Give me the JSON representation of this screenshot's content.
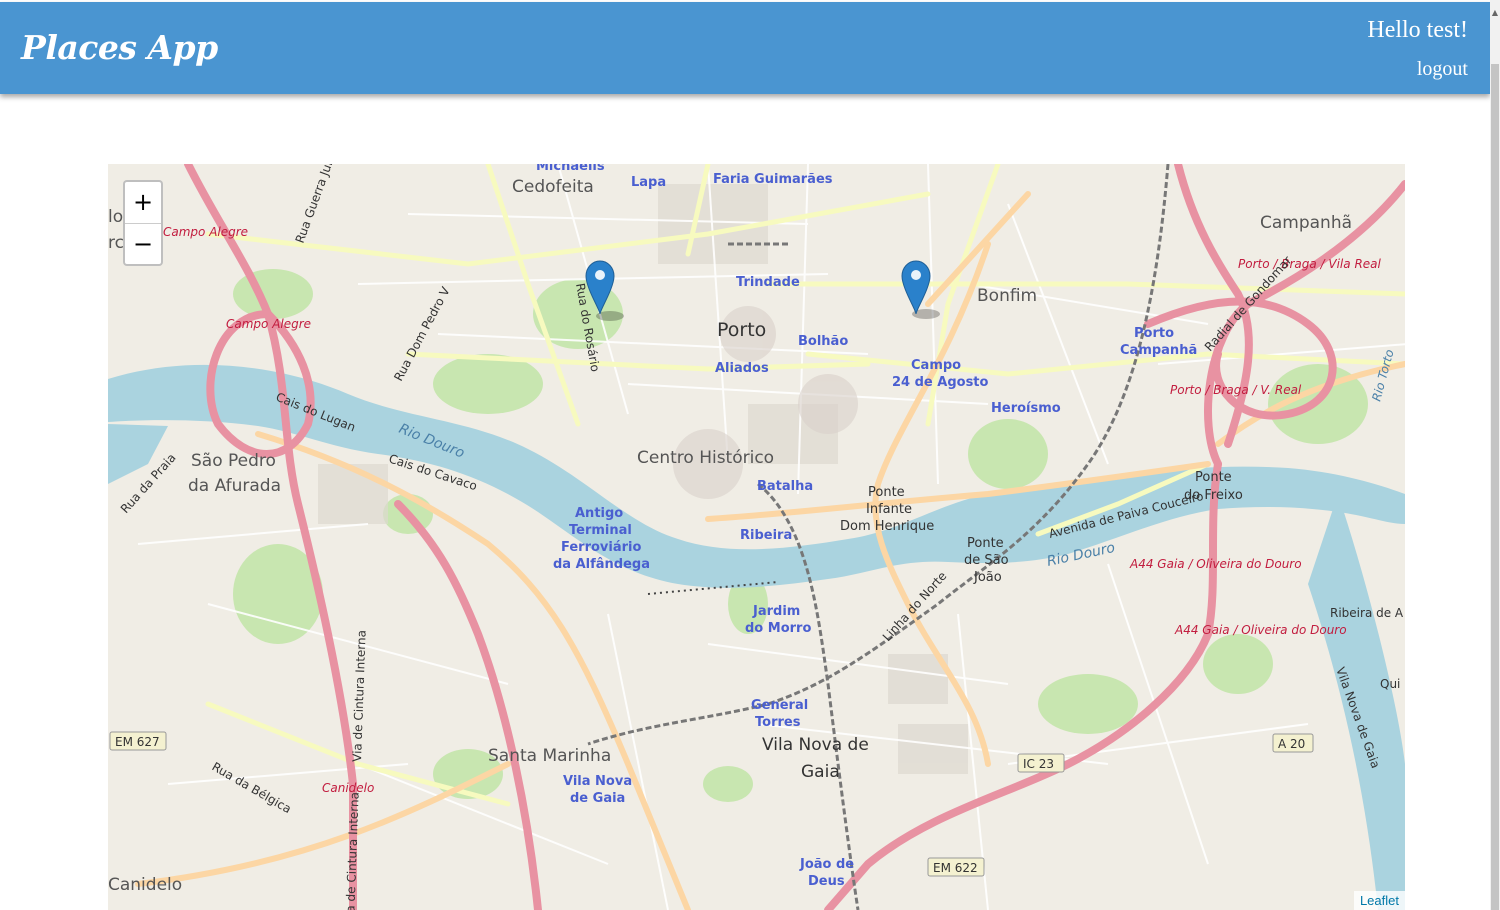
{
  "header": {
    "app_title": "Places App",
    "greeting": "Hello test!",
    "logout_label": "logout",
    "color": "#4a95d1"
  },
  "map": {
    "zoom_in_label": "+",
    "zoom_out_label": "−",
    "attribution": "Leaflet",
    "markers_count": 2,
    "place_labels": {
      "michaelis": "Michaelis",
      "cedofeita": "Cedofeita",
      "lapa": "Lapa",
      "faria_guimaraes": "Faria Guimarães",
      "campanha": "Campanhã",
      "campo_alegre_1": "Campo Alegre",
      "campo_alegre_2": "Campo Alegre",
      "trindade": "Trindade",
      "porto": "Porto",
      "bolhao": "Bolhão",
      "bonfim": "Bonfim",
      "aliados": "Aliados",
      "campo_24": "Campo",
      "campo_24_b": "24 de Agosto",
      "porto_campanha": "Porto",
      "porto_campanha_b": "Campanhã",
      "heroismo": "Heroísmo",
      "centro_historico": "Centro Histórico",
      "sao_pedro": "São Pedro",
      "da_afurada": "da Afurada",
      "batalha": "Batalha",
      "ponte_infante": "Ponte",
      "ponte_infante_b": "Infante",
      "ponte_infante_c": "Dom Henrique",
      "antigo_1": "Antigo",
      "antigo_2": "Terminal",
      "antigo_3": "Ferroviário",
      "antigo_4": "da Alfândega",
      "ribeira": "Ribeira",
      "ponte_sao_joao": "Ponte",
      "ponte_sao_joao_b": "de São",
      "ponte_sao_joao_c": "João",
      "ponte_freixo": "Ponte",
      "ponte_freixo_b": "do Freixo",
      "jardim": "Jardim",
      "jardim_b": "do Morro",
      "general_torres": "General",
      "general_torres_b": "Torres",
      "vila_nova": "Vila Nova de",
      "vila_nova_b": "Gaia",
      "santa_marinha": "Santa Marinha",
      "vila_nova_gaia_st": "Vila Nova",
      "vila_nova_gaia_st_b": "de Gaia",
      "joao_deus": "João de",
      "joao_deus_b": "Deus",
      "canidelo": "Canidelo",
      "canidelo_red": "Canidelo",
      "ribeira_de": "Ribeira de A",
      "qui": "Qui"
    },
    "road_labels": {
      "rio_douro_1": "Rio Douro",
      "rio_douro_2": "Rio Douro",
      "rio_torto": "Rio Torto",
      "porto_braga_vila_real": "Porto / Braga / Vila Real",
      "porto_braga_v_real": "Porto / Braga / V. Real",
      "radial_gondomar": "Radial de Gondomar",
      "rua_guerra": "Rua Guerra Jun",
      "rua_rosario": "Rua do Rosário",
      "rua_dom_pedro": "Rua Dom Pedro V",
      "cais_lugan": "Cais do Lugan",
      "cais_cavaco": "Cais do Cavaco",
      "rua_praia": "Rua da Praia",
      "avenida_paiva": "Avenida de Paiva Couceiro",
      "a44_1": "A44 Gaia / Oliveira do Douro",
      "a44_2": "A44 Gaia / Oliveira do Douro",
      "linha_norte": "Linha do Norte",
      "via_cintura": "Via de Cintura Interna",
      "via_cintura_2": "Via de Cintura Interna",
      "rua_belgica": "Rua da Bélgica",
      "vila_nova_gaia_rd": "Vila Nova de Gaia",
      "shield_em627": "EM 627",
      "shield_ic23": "IC 23",
      "shield_a20": "A 20",
      "shield_em622": "EM 622",
      "lo": "lo",
      "rc": "rc"
    },
    "colors": {
      "land": "#f0ede5",
      "water": "#aad3df",
      "motorway": "#e892a2",
      "primary": "#fcd6a4",
      "secondary": "#f7fabf",
      "green": "#c8e6b0",
      "marker": "#2a81cb",
      "red_label": "#c21d3f",
      "station_label": "#4a5fd0"
    }
  }
}
